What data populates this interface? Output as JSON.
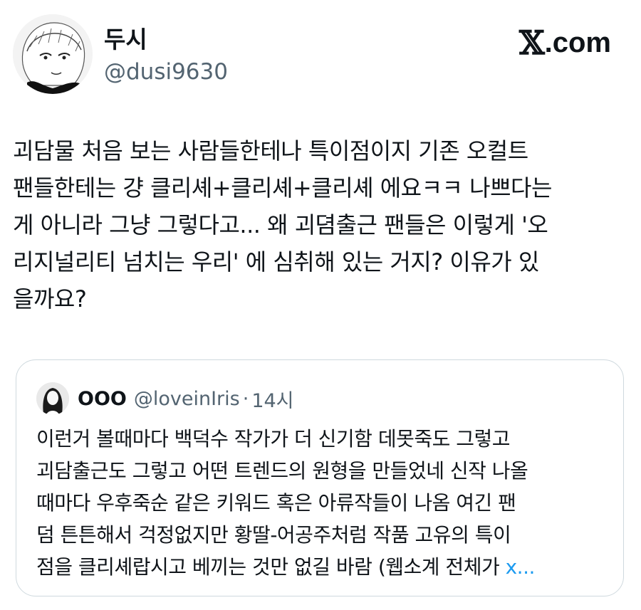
{
  "author": {
    "display_name": "두시",
    "handle": "@dusi9630"
  },
  "brand": {
    "x_glyph": "𝕏",
    "text": ".com"
  },
  "tweet": {
    "lines": [
      "괴담물 처음 보는 사람들한테나 특이점이지 기존 오컬트",
      "팬들한테는 걍 클리셰+클리셰+클리셰 에요ㅋㅋ 나쁘다는",
      "게 아니라 그냥 그렇다고... 왜 괴뎜출근 팬들은 이렇게 '오",
      "리지널리티 넘치는 우리' 에 심취해 있는 거지? 이유가 있",
      "을까요?"
    ]
  },
  "quote": {
    "name": "OOO",
    "handle": "@loveinIris",
    "dot": "·",
    "time": "14시",
    "lines": [
      "이런거 볼때마다 백덕수 작가가 더 신기함 데못죽도 그렇고",
      "괴담출근도 그렇고 어떤 트렌드의 원형을 만들었네 신작 나올",
      "때마다 우후죽순 같은 키워드 혹은 아류작들이 나옴 여긴 팬",
      "덤 튼튼해서 걱정없지만 황딸-어공주처럼 작품 고유의 특이",
      "점을 클리셰랍시고 베끼는 것만 없길 바람 (웹소계 전체가 "
    ],
    "link_text": "x...",
    "link_color": "#1d9bf0"
  },
  "colors": {
    "text": "#0f1419",
    "secondary": "#536471",
    "border": "#cfd9de"
  }
}
